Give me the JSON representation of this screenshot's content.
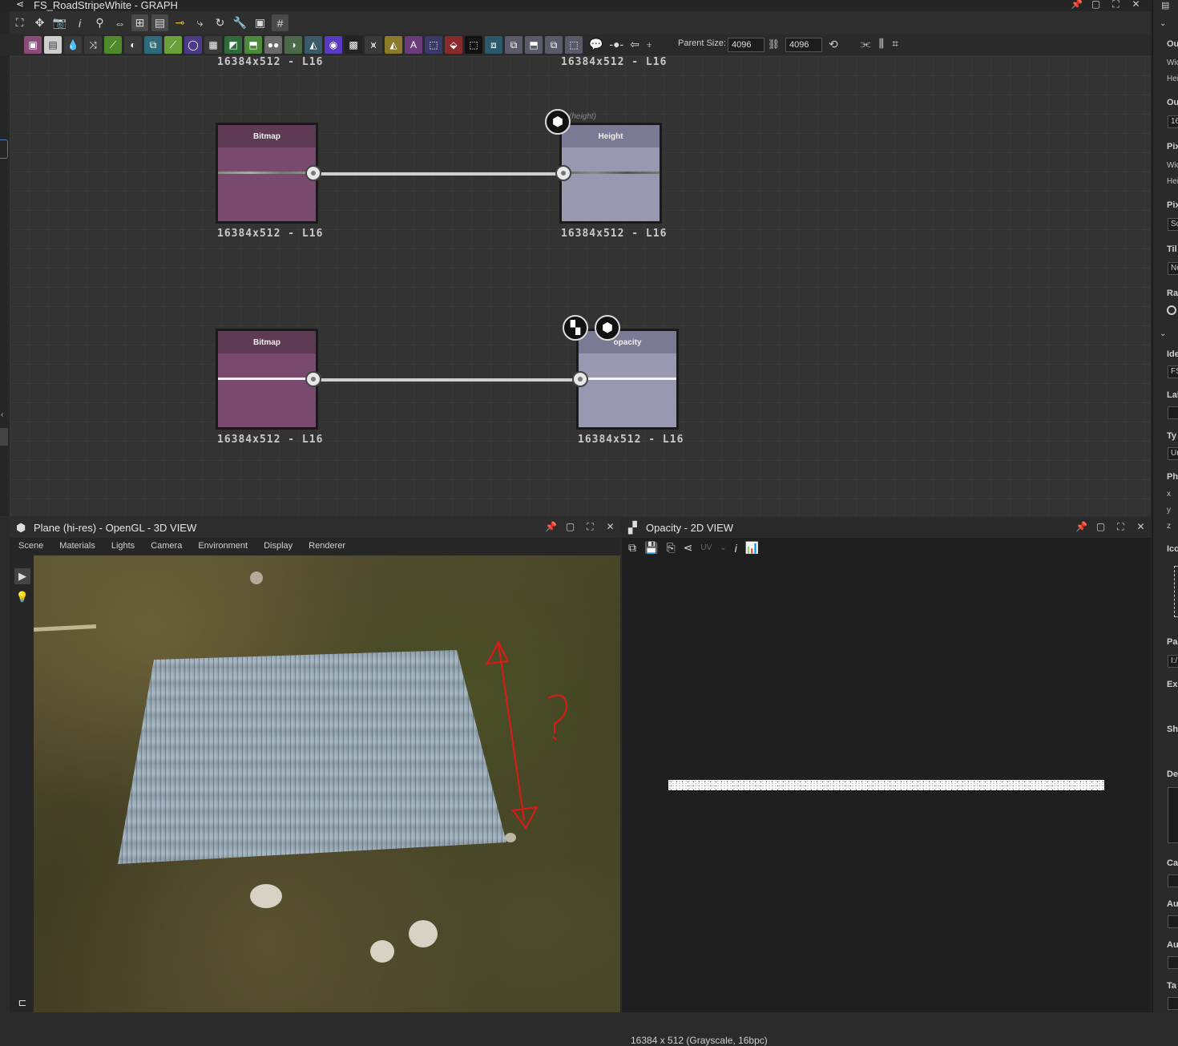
{
  "graph": {
    "title": "FS_RoadStripeWhite - GRAPH",
    "parent_size_label": "Parent Size:",
    "parent_size_value": "4096",
    "output_size_value": "4096",
    "nodes": [
      {
        "label": "Bitmap",
        "resolution": "16384x512 - L16"
      },
      {
        "label": "Height",
        "resolution": "16384x512 - L16",
        "ghost": "(height)"
      },
      {
        "label": "Bitmap",
        "resolution": "16384x512 - L16"
      },
      {
        "label": "opacity",
        "resolution": "16384x512 - L16"
      }
    ],
    "top_resolutions": [
      "16384x512 - L16",
      "16384x512 - L16"
    ]
  },
  "view3d": {
    "title": "Plane (hi-res) - OpenGL - 3D VIEW",
    "menu": [
      "Scene",
      "Materials",
      "Lights",
      "Camera",
      "Environment",
      "Display",
      "Renderer"
    ],
    "annotation": "?"
  },
  "view2d": {
    "title": "Opacity - 2D VIEW",
    "uv_label": "UV",
    "status": "16384 x 512 (Grayscale, 16bpc)"
  },
  "properties": {
    "labels": [
      "Ou",
      "Wic",
      "Hei",
      "Ou",
      "16",
      "Pix",
      "Wic",
      "Hei",
      "Pix",
      "Sc",
      "Til",
      "No",
      "Ra",
      "Ide",
      "FS",
      "Lal",
      "Ty",
      "Ur",
      "Ph",
      "x",
      "y",
      "z",
      "Ico",
      "Pa",
      "I:/",
      "Ex",
      "Sh",
      "De",
      "Ca",
      "Au",
      "Au",
      "Ta"
    ]
  },
  "colors": {
    "bitmap_node": "#7a4a6e",
    "output_node": "#9898b0",
    "annotation": "#e01818"
  }
}
